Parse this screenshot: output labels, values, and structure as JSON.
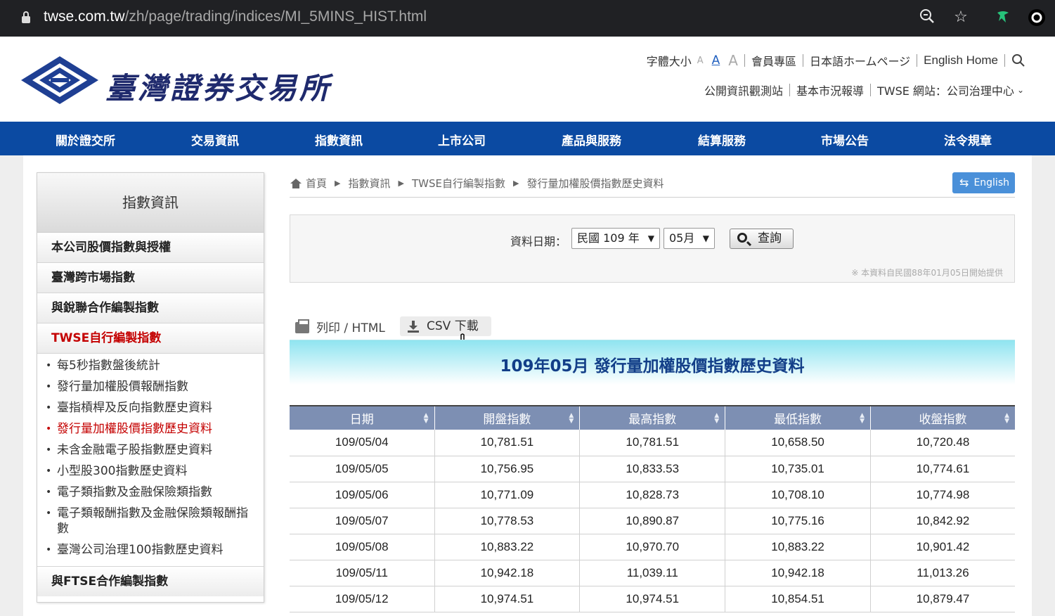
{
  "browser": {
    "url_host": "twse.com.tw",
    "url_path": "/zh/page/trading/indices/MI_5MINS_HIST.html"
  },
  "header": {
    "site_title": "臺灣證券交易所",
    "font_size_label": "字體大小",
    "font_sizes": [
      "A",
      "A",
      "A"
    ],
    "links": [
      "會員專區",
      "日本語ホームページ",
      "English Home"
    ],
    "links2": [
      "公開資訊觀測站",
      "基本市況報導",
      "TWSE 網站：公司治理中心"
    ]
  },
  "nav": [
    "關於證交所",
    "交易資訊",
    "指數資訊",
    "上市公司",
    "產品與服務",
    "結算服務",
    "市場公告",
    "法令規章"
  ],
  "sidebar": {
    "title": "指數資訊",
    "categories": [
      "本公司股價指數與授權",
      "臺灣跨市場指數",
      "與銳聯合作編製指數",
      "TWSE自行編製指數"
    ],
    "sub_items": [
      "每5秒指數盤後統計",
      "發行量加權股價報酬指數",
      "臺指槓桿及反向指數歷史資料",
      "發行量加權股價指數歷史資料",
      "未含金融電子股指數歷史資料",
      "小型股300指數歷史資料",
      "電子類指數及金融保險類指數",
      "電子類報酬指數及金融保險類報酬指數",
      "臺灣公司治理100指數歷史資料"
    ],
    "last_category": "與FTSE合作編製指數"
  },
  "breadcrumb": [
    "首頁",
    "指數資訊",
    "TWSE自行編製指數",
    "發行量加權股價指數歷史資料"
  ],
  "english_button": "English",
  "query": {
    "label": "資料日期：",
    "year": "民國 109 年",
    "month": "05月",
    "button": "查詢",
    "note": "※ 本資料自民國88年01月05日開始提供"
  },
  "tools": {
    "print": "列印 / HTML",
    "csv": "CSV 下載"
  },
  "table_title": "109年05月 發行量加權股價指數歷史資料",
  "table": {
    "headers": [
      "日期",
      "開盤指數",
      "最高指數",
      "最低指數",
      "收盤指數"
    ],
    "rows": [
      [
        "109/05/04",
        "10,781.51",
        "10,781.51",
        "10,658.50",
        "10,720.48"
      ],
      [
        "109/05/05",
        "10,756.95",
        "10,833.53",
        "10,735.01",
        "10,774.61"
      ],
      [
        "109/05/06",
        "10,771.09",
        "10,828.73",
        "10,708.10",
        "10,774.98"
      ],
      [
        "109/05/07",
        "10,778.53",
        "10,890.87",
        "10,775.16",
        "10,842.92"
      ],
      [
        "109/05/08",
        "10,883.22",
        "10,970.70",
        "10,883.22",
        "10,901.42"
      ],
      [
        "109/05/11",
        "10,942.18",
        "11,039.11",
        "10,942.18",
        "11,013.26"
      ],
      [
        "109/05/12",
        "10,974.51",
        "10,974.51",
        "10,854.51",
        "10,879.47"
      ]
    ]
  },
  "colors": {
    "nav_bg": "#0b4aa2",
    "active_red": "#c40000",
    "table_header": "#7d8fb3",
    "title_text": "#123e88"
  }
}
